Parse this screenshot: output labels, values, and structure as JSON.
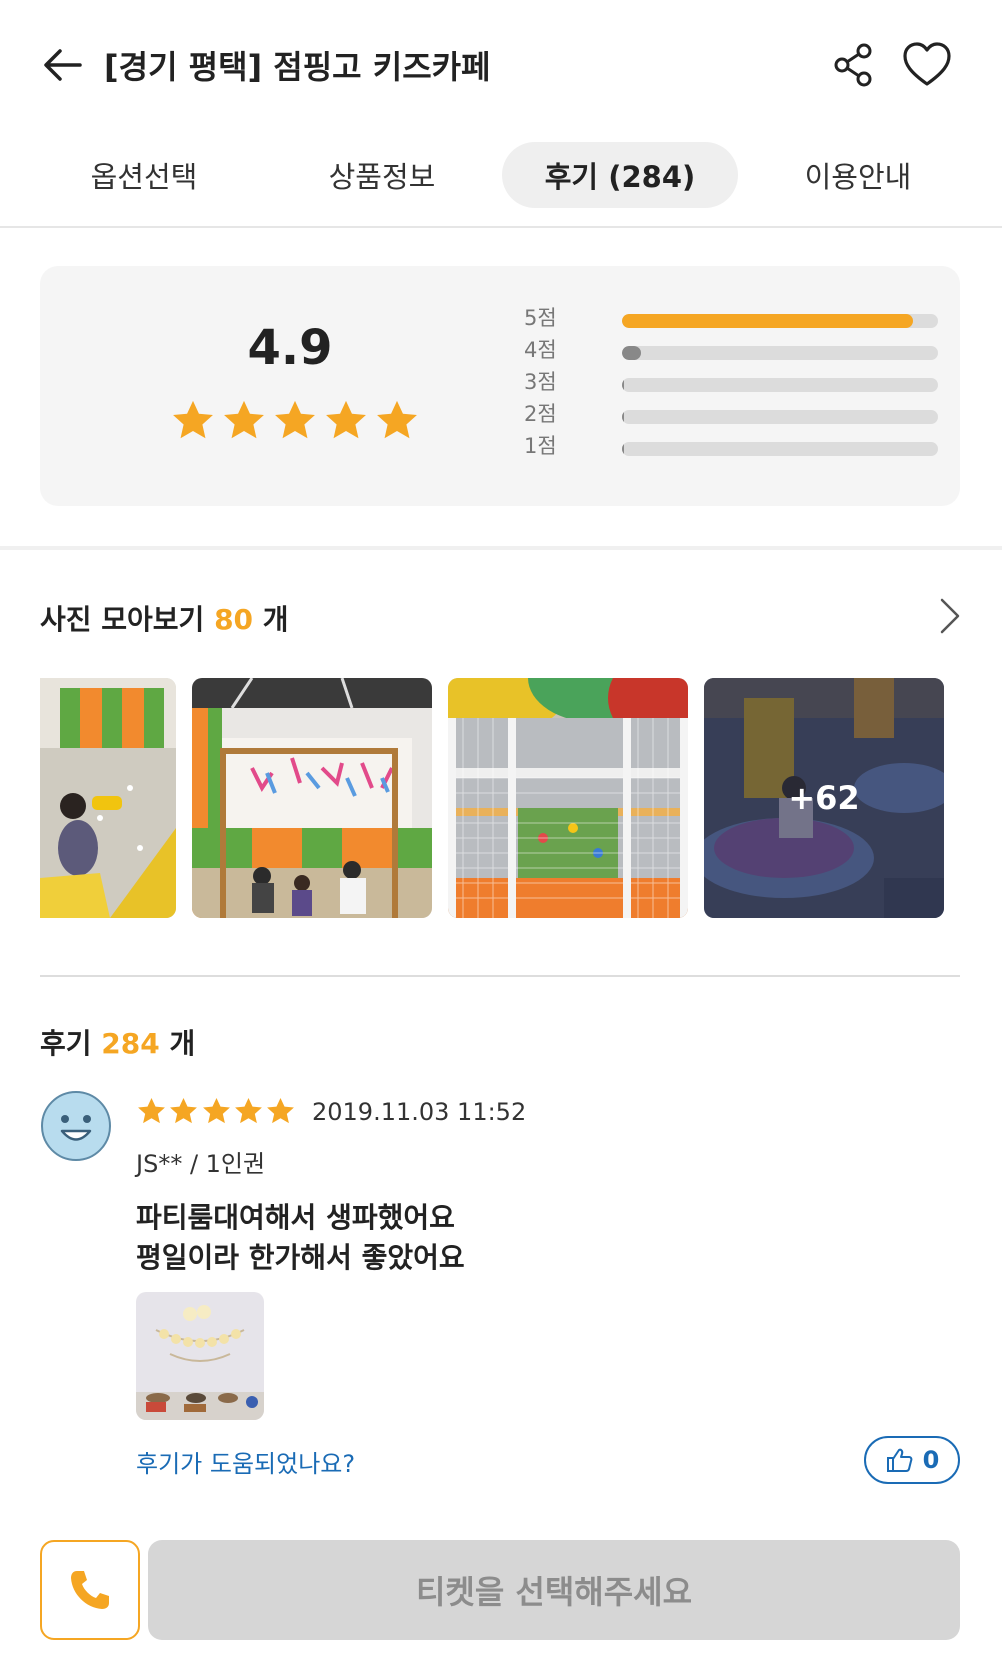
{
  "header": {
    "title": "[경기 평택] 점핑고 키즈카페",
    "back_icon": "arrow-left-icon",
    "share_icon": "share-icon",
    "favorite_icon": "heart-icon"
  },
  "tabs": [
    {
      "label": "옵션선택",
      "active": false
    },
    {
      "label": "상품정보",
      "active": false
    },
    {
      "label": "후기 (284)",
      "active": true
    },
    {
      "label": "이용안내",
      "active": false
    }
  ],
  "rating": {
    "average": "4.9",
    "stars": 5,
    "distribution": [
      {
        "label": "5점",
        "fraction": 0.92
      },
      {
        "label": "4점",
        "fraction": 0.06
      },
      {
        "label": "3점",
        "fraction": 0.0
      },
      {
        "label": "2점",
        "fraction": 0.0
      },
      {
        "label": "1점",
        "fraction": 0.0
      }
    ]
  },
  "photos": {
    "heading": "사진 모아보기",
    "count": "80",
    "unit": "개",
    "more_label": "+62",
    "chevron_icon": "chevron-right-icon"
  },
  "reviews": {
    "heading": "후기",
    "count": "284",
    "unit": "개",
    "items": [
      {
        "stars": 5,
        "date": "2019.11.03 11:52",
        "author": "JS** / 1인권",
        "text_line1": "파티룸대여해서 생파했어요",
        "text_line2": "평일이라 한가해서 좋았어요",
        "helpful_question": "후기가 도움되었나요?",
        "likes": "0"
      }
    ]
  },
  "bottom": {
    "phone_icon": "phone-icon",
    "cta_label": "티켓을 선택해주세요"
  },
  "colors": {
    "accent": "#f5a623",
    "link": "#1a6bb5",
    "cta_disabled": "#d6d6d6"
  }
}
